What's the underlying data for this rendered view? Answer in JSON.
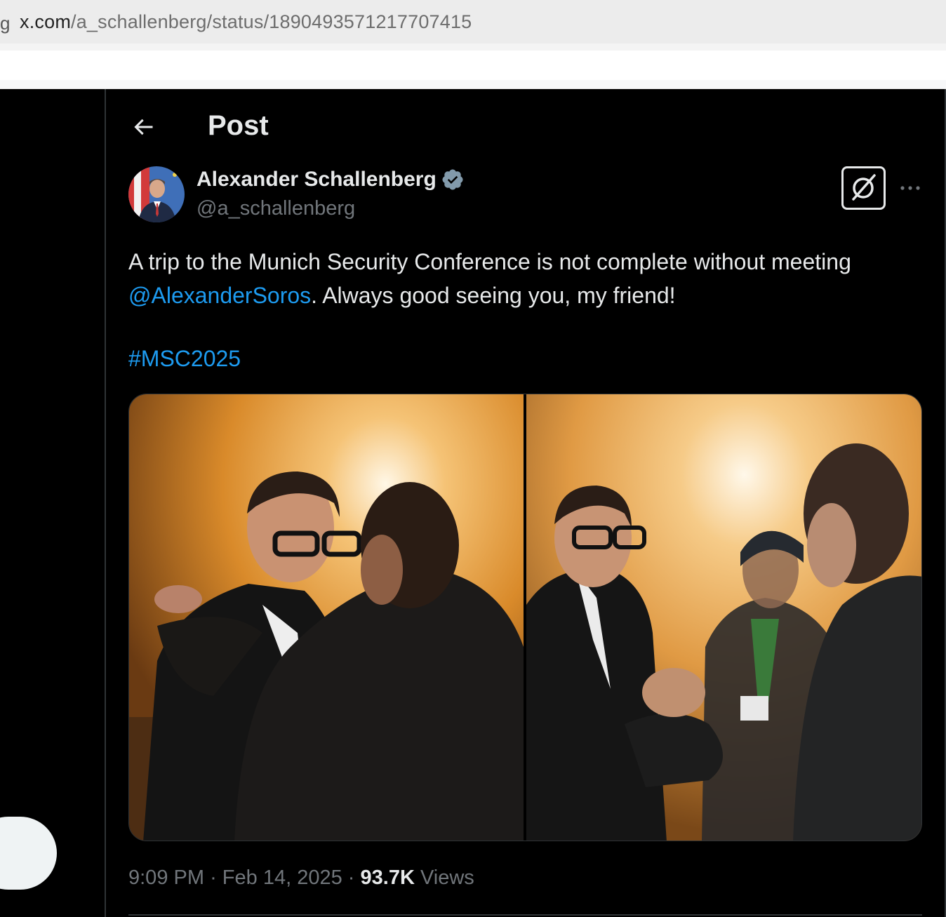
{
  "browser": {
    "url_edge": "g",
    "url_host": "x.com",
    "url_path": "/a_schallenberg/status/1890493571217707415"
  },
  "header": {
    "title": "Post",
    "back_icon": "arrow-left-icon"
  },
  "author": {
    "name": "Alexander Schallenberg",
    "handle": "@a_schallenberg",
    "verified_icon": "verified-badge-icon",
    "verified_color": "#829aab"
  },
  "post": {
    "text_before_mention": "A trip to the Munich Security Conference is not complete without meeting ",
    "mention": "@AlexanderSoros",
    "text_after_mention": ". Always good seeing you, my friend!",
    "hashtag": "#MSC2025",
    "time": "9:09 PM",
    "date": "Feb 14, 2025",
    "views_count": "93.7K",
    "views_label": "Views",
    "separator": "·"
  },
  "actions": {
    "grok_icon": "grok-icon",
    "more_icon": "more-dots-icon"
  },
  "colors": {
    "background": "#000000",
    "text": "#e7e9ea",
    "muted": "#71767b",
    "link": "#1d9bf0",
    "border": "#2f3336"
  }
}
